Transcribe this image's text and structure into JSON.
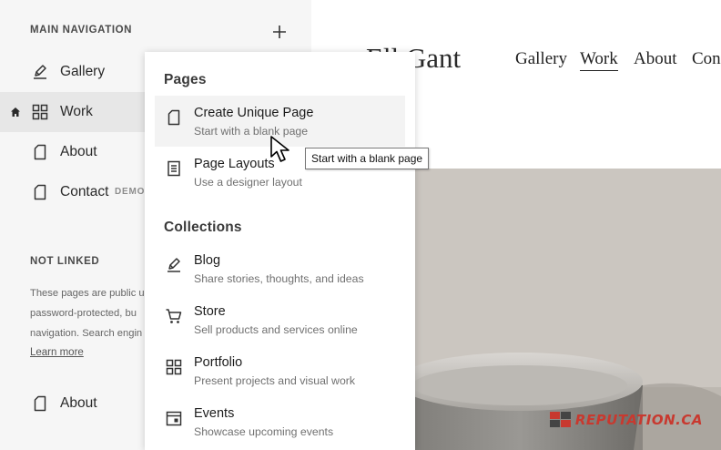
{
  "sidebar": {
    "main_nav_heading": "MAIN NAVIGATION",
    "items": [
      {
        "label": "Gallery",
        "icon": "blog-pen-icon"
      },
      {
        "label": "Work",
        "icon": "grid-icon",
        "active": true,
        "home": true
      },
      {
        "label": "About",
        "icon": "page-icon"
      },
      {
        "label": "Contact",
        "icon": "page-icon",
        "badge": "DEMO"
      }
    ],
    "not_linked_heading": "NOT LINKED",
    "not_linked_text": [
      "These pages are public u",
      "password-protected, bu",
      "navigation. Search engin"
    ],
    "learn_more": "Learn more",
    "not_linked_items": [
      {
        "label": "About",
        "icon": "page-icon"
      }
    ]
  },
  "site": {
    "title": "Ell   Gant",
    "nav": [
      "Gallery",
      "Work",
      "About",
      "Con"
    ],
    "active_nav": "Work",
    "watermark": "REPUTATION.CA"
  },
  "menu": {
    "pages_heading": "Pages",
    "pages": [
      {
        "title": "Create Unique Page",
        "subtitle": "Start with a blank page",
        "icon": "blank-page-icon"
      },
      {
        "title": "Page Layouts",
        "subtitle": "Use a designer layout",
        "icon": "layout-page-icon"
      }
    ],
    "collections_heading": "Collections",
    "collections": [
      {
        "title": "Blog",
        "subtitle": "Share stories, thoughts, and ideas",
        "icon": "blog-pen-icon"
      },
      {
        "title": "Store",
        "subtitle": "Sell products and services online",
        "icon": "cart-icon"
      },
      {
        "title": "Portfolio",
        "subtitle": "Present projects and visual work",
        "icon": "grid-icon"
      },
      {
        "title": "Events",
        "subtitle": "Showcase upcoming events",
        "icon": "calendar-icon"
      }
    ]
  },
  "tooltip": "Start with a blank page"
}
